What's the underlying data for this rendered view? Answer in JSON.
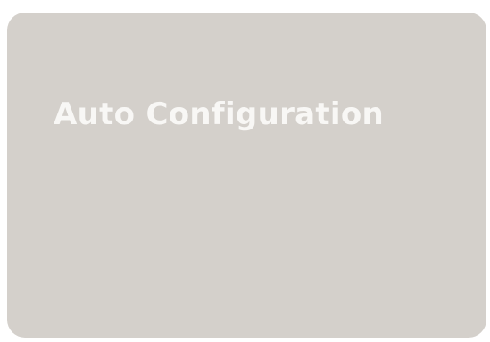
{
  "panel": {
    "title": "Auto Configuration"
  },
  "colors": {
    "panel_background": "#d4d0cb",
    "title_text": "#f8f7f5",
    "page_background": "#ffffff"
  }
}
